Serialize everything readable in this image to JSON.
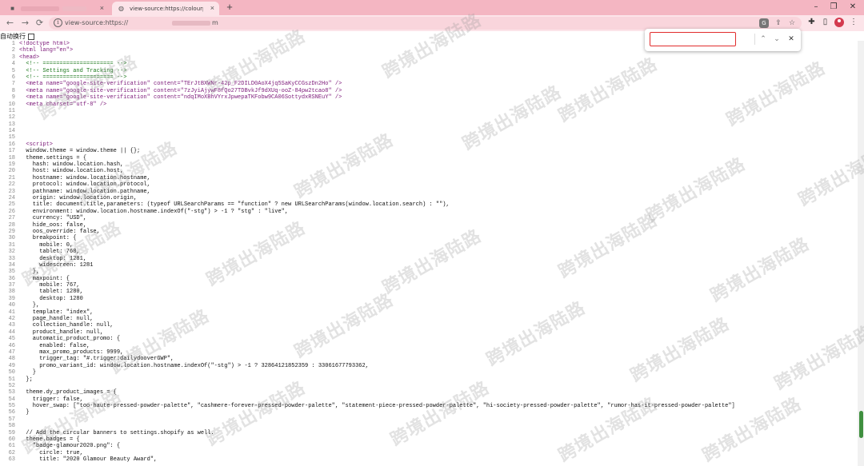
{
  "browser": {
    "active_tab_title": "view-source:https://colourpop",
    "tab_close_glyph": "×",
    "new_tab_glyph": "+",
    "window_controls": [
      "–",
      "❐",
      "✕"
    ],
    "url_prefix": "view-source:https://",
    "url_suffix": "m",
    "nav": {
      "back": "←",
      "forward": "→",
      "reload": "⟳"
    },
    "omnibox_icons": {
      "translate": "G",
      "share": "⇪",
      "star": "☆"
    },
    "extensions": {
      "puzzle": "✚",
      "sidepanel": "▯"
    },
    "menu_glyph": "⋮"
  },
  "wrap": {
    "label": "自动换行"
  },
  "find": {
    "query": "",
    "prev_glyph": "⌃",
    "next_glyph": "⌄",
    "close_glyph": "✕"
  },
  "watermark": {
    "text": "跨境出海陆路"
  },
  "source_lines": [
    {
      "n": "1",
      "text": "<!doctype html>",
      "kind": "tag"
    },
    {
      "n": "2",
      "text": "<html lang=\"en\">",
      "kind": "tag"
    },
    {
      "n": "3",
      "text": "<head>",
      "kind": "tag"
    },
    {
      "n": "4",
      "text": "  <!-- ===================== -->",
      "kind": "cmt"
    },
    {
      "n": "5",
      "text": "  <!-- Settings and Tracking -->",
      "kind": "cmt"
    },
    {
      "n": "6",
      "text": "  <!-- ===================== -->",
      "kind": "cmt"
    },
    {
      "n": "7",
      "text": "  <meta name=\"google-site-verification\" content=\"TErJtBXWNr-42p_F2DILD0AoX4jq5SaKyCCGszDn2Ho\" />",
      "kind": "meta"
    },
    {
      "n": "8",
      "text": "  <meta name=\"google-site-verification\" content=\"7zJyiAjywF8fQo27TDBvkJf9dXUq-ooZ-84pw2tcao8\" />",
      "kind": "meta"
    },
    {
      "n": "9",
      "text": "  <meta name=\"google-site-verification\" content=\"ndqIMoXBhVYrxJpwepaTKFobw9CA06SottydxRSNEuY\" />",
      "kind": "meta"
    },
    {
      "n": "10",
      "text": "  <meta charset=\"utf-8\" />",
      "kind": "meta"
    },
    {
      "n": "11",
      "text": "",
      "kind": "plain"
    },
    {
      "n": "12",
      "text": "",
      "kind": "plain"
    },
    {
      "n": "13",
      "text": "",
      "kind": "plain"
    },
    {
      "n": "14",
      "text": "",
      "kind": "plain"
    },
    {
      "n": "15",
      "text": "",
      "kind": "plain"
    },
    {
      "n": "16",
      "text": "  <script>",
      "kind": "tag"
    },
    {
      "n": "17",
      "text": "  window.theme = window.theme || {};",
      "kind": "plain"
    },
    {
      "n": "18",
      "text": "  theme.settings = {",
      "kind": "plain"
    },
    {
      "n": "19",
      "text": "    hash: window.location.hash,",
      "kind": "plain"
    },
    {
      "n": "20",
      "text": "    host: window.location.host,",
      "kind": "plain"
    },
    {
      "n": "21",
      "text": "    hostname: window.location.hostname,",
      "kind": "plain"
    },
    {
      "n": "22",
      "text": "    protocol: window.location.protocol,",
      "kind": "plain"
    },
    {
      "n": "23",
      "text": "    pathname: window.location.pathname,",
      "kind": "plain"
    },
    {
      "n": "24",
      "text": "    origin: window.location.origin,",
      "kind": "plain"
    },
    {
      "n": "25",
      "text": "    title: document.title,parameters: (typeof URLSearchParams == \"function\" ? new URLSearchParams(window.location.search) : \"\"),",
      "kind": "plain"
    },
    {
      "n": "26",
      "text": "    environment: window.location.hostname.indexOf(\"-stg\") > -1 ? \"stg\" : \"live\",",
      "kind": "plain"
    },
    {
      "n": "27",
      "text": "    currency: \"USD\",",
      "kind": "plain"
    },
    {
      "n": "28",
      "text": "    hide_oos: false,",
      "kind": "plain"
    },
    {
      "n": "29",
      "text": "    oos_override: false,",
      "kind": "plain"
    },
    {
      "n": "30",
      "text": "    breakpoint: {",
      "kind": "plain"
    },
    {
      "n": "31",
      "text": "      mobile: 0,",
      "kind": "plain"
    },
    {
      "n": "32",
      "text": "      tablet: 768,",
      "kind": "plain"
    },
    {
      "n": "33",
      "text": "      desktop: 1281,",
      "kind": "plain"
    },
    {
      "n": "34",
      "text": "      widescreen: 1281",
      "kind": "plain"
    },
    {
      "n": "35",
      "text": "    },",
      "kind": "plain"
    },
    {
      "n": "36",
      "text": "    maxpoint: {",
      "kind": "plain"
    },
    {
      "n": "37",
      "text": "      mobile: 767,",
      "kind": "plain"
    },
    {
      "n": "38",
      "text": "      tablet: 1280,",
      "kind": "plain"
    },
    {
      "n": "39",
      "text": "      desktop: 1280",
      "kind": "plain"
    },
    {
      "n": "40",
      "text": "    },",
      "kind": "plain"
    },
    {
      "n": "41",
      "text": "    template: \"index\",",
      "kind": "plain"
    },
    {
      "n": "42",
      "text": "    page_handle: null,",
      "kind": "plain"
    },
    {
      "n": "43",
      "text": "    collection_handle: null,",
      "kind": "plain"
    },
    {
      "n": "44",
      "text": "    product_handle: null,",
      "kind": "plain"
    },
    {
      "n": "45",
      "text": "    automatic_product_promo: {",
      "kind": "plain"
    },
    {
      "n": "46",
      "text": "      enabled: false,",
      "kind": "plain"
    },
    {
      "n": "47",
      "text": "      max_promo_products: 9999,",
      "kind": "plain"
    },
    {
      "n": "48",
      "text": "      trigger_tag: \"#.trigger:dailydooverGWP\",",
      "kind": "plain"
    },
    {
      "n": "49",
      "text": "      promo_variant_id: window.location.hostname.indexOf(\"-stg\") > -1 ? 32864121852359 : 33061677793362,",
      "kind": "plain"
    },
    {
      "n": "50",
      "text": "    }",
      "kind": "plain"
    },
    {
      "n": "51",
      "text": "  };",
      "kind": "plain"
    },
    {
      "n": "52",
      "text": "",
      "kind": "plain"
    },
    {
      "n": "53",
      "text": "  theme.dy_product_images = {",
      "kind": "plain"
    },
    {
      "n": "54",
      "text": "    trigger: false,",
      "kind": "plain"
    },
    {
      "n": "55",
      "text": "    hover_swap: [\"too-haute-pressed-powder-palette\", \"cashmere-forever-pressed-powder-palette\", \"statement-piece-pressed-powder-palette\", \"hi-society-pressed-powder-palette\", \"rumor-has-it-pressed-powder-palette\"]",
      "kind": "plain"
    },
    {
      "n": "56",
      "text": "  }",
      "kind": "plain"
    },
    {
      "n": "57",
      "text": "",
      "kind": "plain"
    },
    {
      "n": "58",
      "text": "",
      "kind": "plain"
    },
    {
      "n": "59",
      "text": "  // Add the circular banners to settings.shopify as well.",
      "kind": "plain"
    },
    {
      "n": "60",
      "text": "  theme.badges = {",
      "kind": "plain"
    },
    {
      "n": "61",
      "text": "    \"badge-glamour2020.png\": {",
      "kind": "plain"
    },
    {
      "n": "62",
      "text": "      circle: true,",
      "kind": "plain"
    },
    {
      "n": "63",
      "text": "      title: \"2020 Glamour Beauty Award\",",
      "kind": "plain"
    }
  ]
}
